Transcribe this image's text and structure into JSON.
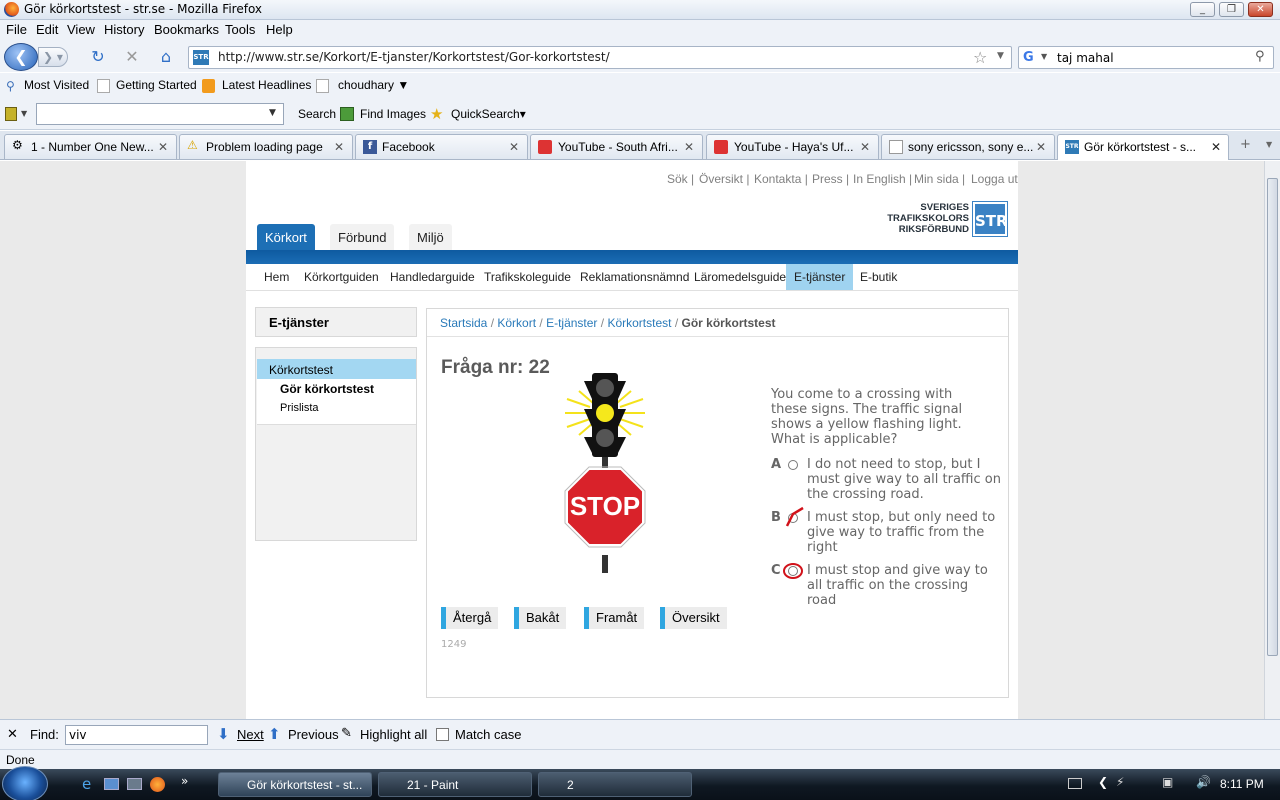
{
  "window": {
    "title": "Gör körkortstest - str.se - Mozilla Firefox"
  },
  "menu": [
    "File",
    "Edit",
    "View",
    "History",
    "Bookmarks",
    "Tools",
    "Help"
  ],
  "nav": {
    "url": "http://www.str.se/Korkort/E-tjanster/Korkortstest/Gor-korkortstest/",
    "search_value": "taj mahal"
  },
  "bookmarks": [
    "Most Visited",
    "Getting Started",
    "Latest Headlines",
    "choudhary ▼"
  ],
  "toolbar2": {
    "search": "Search",
    "find_images": "Find Images",
    "quicksearch": "QuickSearch▾"
  },
  "tabs": [
    {
      "label": "1 - Number One New..."
    },
    {
      "label": "Problem loading page"
    },
    {
      "label": "Facebook"
    },
    {
      "label": "YouTube - South Afri..."
    },
    {
      "label": "YouTube - Haya's Uf..."
    },
    {
      "label": "sony ericsson, sony e..."
    },
    {
      "label": "Gör körkortstest - s..."
    }
  ],
  "site": {
    "util_links": [
      "Sök |",
      "Översikt |",
      "Kontakta |",
      "Press |",
      "In English |",
      "Min sida |",
      "Logga ut"
    ],
    "logo": {
      "line1": "SVERIGES",
      "line2": "TRAFIKSKOLORS",
      "line3": "RIKSFÖRBUND",
      "badge": "STR"
    },
    "main_tabs": [
      "Körkort",
      "Förbund",
      "Miljö"
    ],
    "subnav": [
      "Hem",
      "Körkortguiden",
      "Handledarguide",
      "Trafikskoleguide",
      "Reklamationsnämnd",
      "Läromedelsguide",
      "E-tjänster",
      "E-butik"
    ],
    "sidebar": {
      "title": "E-tjänster",
      "item1": "Körkortstest",
      "item2": "Gör körkortstest",
      "item3": "Prislista"
    },
    "breadcrumb": {
      "b1": "Startsida",
      "b2": "Körkort",
      "b3": "E-tjänster",
      "b4": "Körkortstest",
      "current": "Gör körkortstest",
      "sep": " / "
    },
    "question": {
      "title": "Fråga nr: 22",
      "text": "You come to a crossing with these signs. The traffic signal shows a yellow flashing light. What is applicable?",
      "sign_text": "STOP",
      "answers": [
        {
          "letter": "A",
          "text": "I do not need to stop, but I must give way to all traffic on the crossing road."
        },
        {
          "letter": "B",
          "text": "I must stop, but only need to give way to traffic from the right"
        },
        {
          "letter": "C",
          "text": "I must stop and give way to all traffic on the crossing road"
        }
      ],
      "buttons": [
        "Återgå",
        "Bakåt",
        "Framåt",
        "Översikt"
      ],
      "id": "1249"
    }
  },
  "findbar": {
    "label": "Find:",
    "value": "viv",
    "next": "Next",
    "previous": "Previous",
    "highlight": "Highlight all",
    "match_case": "Match case"
  },
  "status": "Done",
  "taskbar": {
    "tasks": [
      "Gör körkortstest - st...",
      "21 - Paint",
      "2"
    ],
    "clock": "8:11 PM"
  }
}
